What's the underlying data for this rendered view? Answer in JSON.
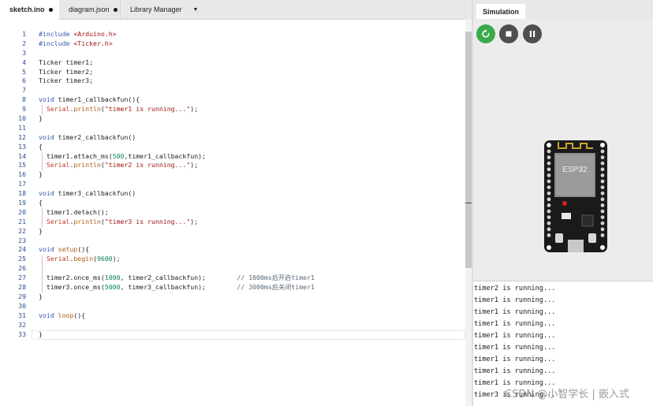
{
  "editor": {
    "tabs": [
      {
        "label": "sketch.ino",
        "modified": true,
        "active": true
      },
      {
        "label": "diagram.json",
        "modified": true,
        "active": false
      },
      {
        "label": "Library Manager",
        "modified": false,
        "active": false
      }
    ],
    "lines": [
      {
        "n": "1",
        "html": "<span class='kw'>#include</span> <span class='str'>&lt;Arduino.h&gt;</span>"
      },
      {
        "n": "2",
        "html": "<span class='kw'>#include</span> <span class='str'>&lt;Ticker.h&gt;</span>"
      },
      {
        "n": "3",
        "html": ""
      },
      {
        "n": "4",
        "html": "Ticker timer1;"
      },
      {
        "n": "5",
        "html": "Ticker timer2;"
      },
      {
        "n": "6",
        "html": "Ticker timer3;"
      },
      {
        "n": "7",
        "html": ""
      },
      {
        "n": "8",
        "html": "<span class='kw'>void</span> timer1_callbackfun(){"
      },
      {
        "n": "9",
        "html": "  <span class='serial'>Serial</span>.<span class='fn'>println</span>(<span class='str'>\"timer1 is running...\"</span>);"
      },
      {
        "n": "10",
        "html": "}"
      },
      {
        "n": "11",
        "html": ""
      },
      {
        "n": "12",
        "html": "<span class='kw'>void</span> timer2_callbackfun()"
      },
      {
        "n": "13",
        "html": "{"
      },
      {
        "n": "14",
        "html": "  timer1.attach_ms(<span class='num'>500</span>,timer1_callbackfun);"
      },
      {
        "n": "15",
        "html": "  <span class='serial'>Serial</span>.<span class='fn'>println</span>(<span class='str'>\"timer2 is running...\"</span>);"
      },
      {
        "n": "16",
        "html": "}"
      },
      {
        "n": "17",
        "html": ""
      },
      {
        "n": "18",
        "html": "<span class='kw'>void</span> timer3_callbackfun()"
      },
      {
        "n": "19",
        "html": "{"
      },
      {
        "n": "20",
        "html": "  timer1.detach();"
      },
      {
        "n": "21",
        "html": "  <span class='serial'>Serial</span>.<span class='fn'>println</span>(<span class='str'>\"timer3 is running...\"</span>);"
      },
      {
        "n": "22",
        "html": "}"
      },
      {
        "n": "23",
        "html": ""
      },
      {
        "n": "24",
        "html": "<span class='kw'>void</span> <span class='fn'>setup</span>(){"
      },
      {
        "n": "25",
        "html": "  <span class='serial'>Serial</span>.<span class='fn'>begin</span>(<span class='num'>9600</span>);"
      },
      {
        "n": "26",
        "html": ""
      },
      {
        "n": "27",
        "html": "  timer2.once_ms(<span class='num'>1000</span>, timer2_callbackfun);        <span class='cm'>// 1000ms后开启timer1</span>"
      },
      {
        "n": "28",
        "html": "  timer3.once_ms(<span class='num'>5000</span>, timer3_callbackfun);        <span class='cm'>// 3000ms后关闭timer1</span>"
      },
      {
        "n": "29",
        "html": "}"
      },
      {
        "n": "30",
        "html": ""
      },
      {
        "n": "31",
        "html": "<span class='kw'>void</span> <span class='fn'>loop</span>(){"
      },
      {
        "n": "32",
        "html": ""
      },
      {
        "n": "33",
        "html": "}"
      }
    ]
  },
  "simulation": {
    "tab_label": "Simulation",
    "board_chip_label": "ESP32",
    "controls": [
      {
        "name": "restart-button",
        "icon": "restart-icon"
      },
      {
        "name": "stop-button",
        "icon": "stop-icon"
      },
      {
        "name": "pause-button",
        "icon": "pause-icon"
      }
    ]
  },
  "serial_monitor": {
    "lines": [
      "timer2 is running...",
      "timer1 is running...",
      "timer1 is running...",
      "timer1 is running...",
      "timer1 is running...",
      "timer1 is running...",
      "timer1 is running...",
      "timer1 is running...",
      "timer1 is running...",
      "timer3 is running..."
    ]
  },
  "watermark": "CSDN @小智学长 | 嵌入式",
  "colors": {
    "restart": "#3aab4a",
    "control_dark": "#4f4f4f",
    "board": "#1a1a1a"
  }
}
